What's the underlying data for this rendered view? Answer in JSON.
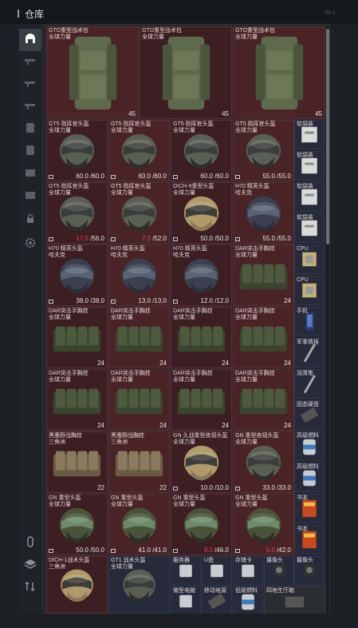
{
  "header": {
    "title": "仓库",
    "right_label": "06-1"
  },
  "sidebar": {
    "items": [
      {
        "name": "sidebar-item-storage",
        "icon": "storage-icon",
        "active": true
      },
      {
        "name": "sidebar-item-tab-2",
        "icon": "weapon-icon",
        "active": false
      },
      {
        "name": "sidebar-item-tab-3",
        "icon": "weapon-icon",
        "active": false
      },
      {
        "name": "sidebar-item-tab-4",
        "icon": "weapon-icon",
        "active": false
      },
      {
        "name": "sidebar-item-tab-5",
        "icon": "armor-icon",
        "active": false
      },
      {
        "name": "sidebar-item-tab-6",
        "icon": "armor-icon",
        "active": false
      },
      {
        "name": "sidebar-item-tab-7",
        "icon": "bag-icon",
        "active": false
      },
      {
        "name": "sidebar-item-tab-8",
        "icon": "bag-icon",
        "active": false
      },
      {
        "name": "sidebar-item-lock",
        "icon": "lock-icon",
        "active": false
      },
      {
        "name": "sidebar-item-settings",
        "icon": "gear-icon",
        "active": false
      },
      {
        "name": "sidebar-item-capsule",
        "icon": "capsule-icon",
        "active": false
      },
      {
        "name": "sidebar-item-layers",
        "icon": "layers-icon",
        "active": false
      },
      {
        "name": "sidebar-item-sort",
        "icon": "sort-icon",
        "active": false
      }
    ]
  },
  "items": {
    "vest1": {
      "name": "GTO重型战术包\n全球力量",
      "qty": "45"
    },
    "vest2": {
      "name": "GTO重型战术包\n全球力量",
      "qty": "45"
    },
    "vest3": {
      "name": "GTO重型战术包\n全球力量",
      "qty": "45"
    },
    "h1": {
      "name": "GT5 指挥官头盔\n全球力量",
      "dur": "60.0 /60.0"
    },
    "h2": {
      "name": "GT5 指挥官头盔\n全球力量",
      "dur": "60.0 /60.0"
    },
    "h3": {
      "name": "GT5 指挥官头盔\n全球力量",
      "dur": "60.0 /60.0"
    },
    "h4": {
      "name": "GT5 指挥官头盔\n全球力量",
      "dur": "55.0 /55.0"
    },
    "h5": {
      "name": "GT5 指挥官头盔\n全球力量",
      "dur_low": "17.0",
      "dur_rest": " /56.0"
    },
    "h6": {
      "name": "GT5 指挥官头盔\n全球力量",
      "dur_low": "7.0",
      "dur_rest": " /52.0"
    },
    "h7": {
      "name": "DICH-9重型头盔\n全球力量",
      "dur": "50.0 /50.0"
    },
    "h8": {
      "name": "H70 精英头盔\n哈夫克",
      "dur": "55.0 /55.0"
    },
    "h9": {
      "name": "H70 精英头盔\n哈夫克",
      "dur": "38.0 /38.0"
    },
    "h10": {
      "name": "H70 精英头盔\n哈夫克",
      "dur": "13.0 /13.0"
    },
    "h11": {
      "name": "H70 精英头盔\n哈夫克",
      "dur": "12.0 /12.0"
    },
    "c1": {
      "name": "DAR突击手胸挂\n全球力量",
      "qty": "24"
    },
    "c2": {
      "name": "DAR突击手胸挂\n全球力量",
      "qty": "24"
    },
    "c3": {
      "name": "DAR突击手胸挂\n全球力量",
      "qty": "24"
    },
    "c4": {
      "name": "DAR突击手胸挂\n全球力量",
      "qty": "24"
    },
    "c5": {
      "name": "DAR突击手胸挂\n全球力量",
      "qty": "24"
    },
    "c6": {
      "name": "DAR突击手胸挂\n全球力量",
      "qty": "24"
    },
    "c7": {
      "name": "DAR突击手胸挂\n全球力量",
      "qty": "24"
    },
    "c8": {
      "name": "DAR突击手胸挂\n全球力量",
      "qty": "24"
    },
    "c9": {
      "name": "DAR突击手胸挂\n全球力量",
      "qty": "24"
    },
    "c10": {
      "name": "黑鹰野战胸挂\n三角洲",
      "qty": "22"
    },
    "c11": {
      "name": "黑鹰野战胸挂\n三角洲",
      "qty": "22"
    },
    "g1": {
      "name": "GN 久战重型夜视头盔\n全球力量",
      "dur": "10.0 /10.0"
    },
    "g2": {
      "name": "GN 重型夜视头盔\n全球力量",
      "dur": "33.0 /33.0"
    },
    "g3": {
      "name": "GN 重型头盔\n全球力量",
      "dur": "50.0 /50.0"
    },
    "g4": {
      "name": "GN 重型头盔\n全球力量",
      "dur": "41.0 /41.0"
    },
    "g5": {
      "name": "GN 重型头盔\n全球力量",
      "dur_low": "9.0",
      "dur_rest": " /46.0"
    },
    "g6": {
      "name": "GN 重型头盔\n全球力量",
      "dur_low": "5.0",
      "dur_rest": " /42.0"
    },
    "g7": {
      "name": "DICH-1战术头盔\n三角洲"
    },
    "g8": {
      "name": "GT1 战术头盔\n全球力量"
    },
    "s1": {
      "name": "软袋装"
    },
    "s2": {
      "name": "软袋装"
    },
    "s3": {
      "name": "软袋装"
    },
    "s4": {
      "name": "软袋装"
    },
    "s5": {
      "name": "CPU"
    },
    "s6": {
      "name": "CPU"
    },
    "s7": {
      "name": "手机"
    },
    "s8": {
      "name": "军事情报"
    },
    "s9": {
      "name": "润滑笔"
    },
    "s10": {
      "name": "固态硬盘"
    },
    "s11": {
      "name": "高级燃料"
    },
    "s12": {
      "name": "高级燃料"
    },
    "s13": {
      "name": "书本"
    },
    "s14": {
      "name": "书本"
    },
    "m1": {
      "name": "服务器"
    },
    "m2": {
      "name": "U盘"
    },
    "m3": {
      "name": "存储卡"
    },
    "m4": {
      "name": "摄像头"
    },
    "m5": {
      "name": "摄像头"
    },
    "m6": {
      "name": "微型电脑"
    },
    "m7": {
      "name": "移动电源"
    },
    "m8": {
      "name": "低级燃料"
    },
    "m9": {
      "name": "四地生厅箱"
    }
  },
  "colors": {
    "slot_red": "#4a2327",
    "slot_blue": "#262a3a",
    "durability_low": "#e04848",
    "frame": "#23272b"
  }
}
